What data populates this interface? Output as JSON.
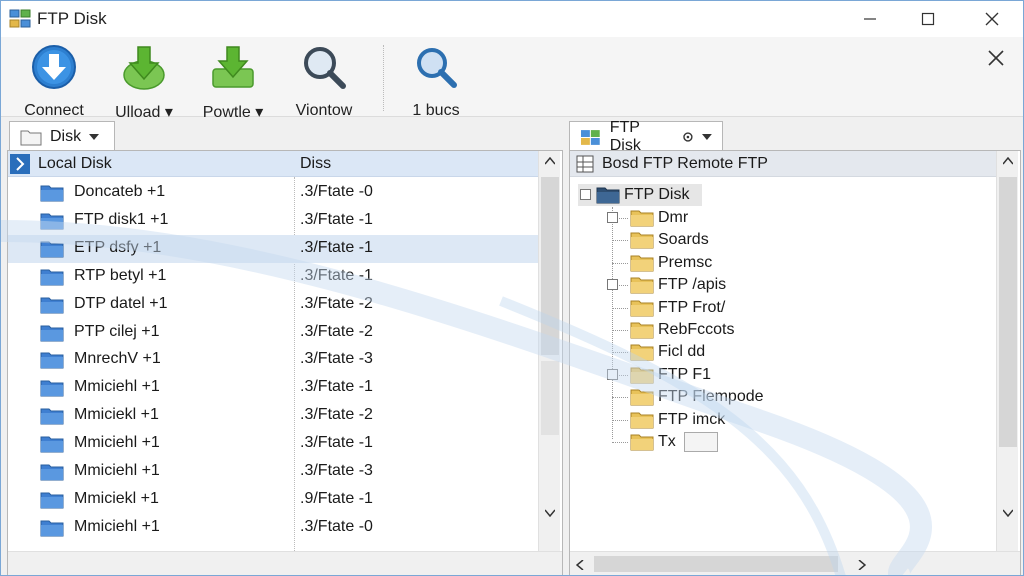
{
  "window": {
    "title": "FTP Disk",
    "title_icon": "app-network-icon"
  },
  "toolbar": {
    "items": [
      {
        "label": "Connect",
        "icon": "download-arrow-icon",
        "color": "#2d7fd0"
      },
      {
        "label": "Ulload ▾",
        "icon": "green-down-arrow-icon",
        "color": "#5cb532"
      },
      {
        "label": "Powtle ▾",
        "icon": "green-down-arrow-icon",
        "color": "#5cb532"
      },
      {
        "label": "Viontow",
        "icon": "magnifier-icon"
      },
      {
        "label": "1 bucs",
        "icon": "magnifier-icon"
      }
    ]
  },
  "left": {
    "tab_label": "Disk",
    "header_name": "Local Disk",
    "header_col": "Diss",
    "rows": [
      {
        "name": "Doncateb +1",
        "value": ".3/Ftate -0"
      },
      {
        "name": "FTP disk1 +1",
        "value": ".3/Ftate -1"
      },
      {
        "name": "ETP dsfy +1",
        "value": ".3/Ftate -1",
        "selected": true
      },
      {
        "name": "RTP betyl +1",
        "value": ".3/Ftate -1"
      },
      {
        "name": "DTP datel +1",
        "value": ".3/Ftate -2"
      },
      {
        "name": "PTP cilej +1",
        "value": ".3/Ftate -2"
      },
      {
        "name": "MnrechV +1",
        "value": ".3/Ftate -3"
      },
      {
        "name": "Mmiciehl +1",
        "value": ".3/Ftate -1"
      },
      {
        "name": "Mmiciekl +1",
        "value": ".3/Ftate -2"
      },
      {
        "name": "Mmiciehl +1",
        "value": ".3/Ftate -1"
      },
      {
        "name": "Mmiciehl +1",
        "value": ".3/Ftate -3"
      },
      {
        "name": "Mmiciekl +1",
        "value": ".9/Ftate -1"
      },
      {
        "name": "Mmiciehl +1",
        "value": ".3/Ftate -0"
      }
    ]
  },
  "right": {
    "tab_label": "FTP Disk",
    "header": "Bosd FTP Remote FTP",
    "root": "FTP Disk",
    "nodes": [
      "Dmr",
      "Soards",
      "Premsc",
      "FTP /apis",
      "FTP Frot/",
      "RebFccots",
      "Ficl dd",
      "FTP F1",
      "FTP Flempode",
      "FTP imck",
      "Tx"
    ]
  },
  "colors": {
    "selection": "#dde8f5",
    "header_bg": "#dbe7f6",
    "folder": "#3f7fd1",
    "tree_folder": "#e8c25a"
  }
}
